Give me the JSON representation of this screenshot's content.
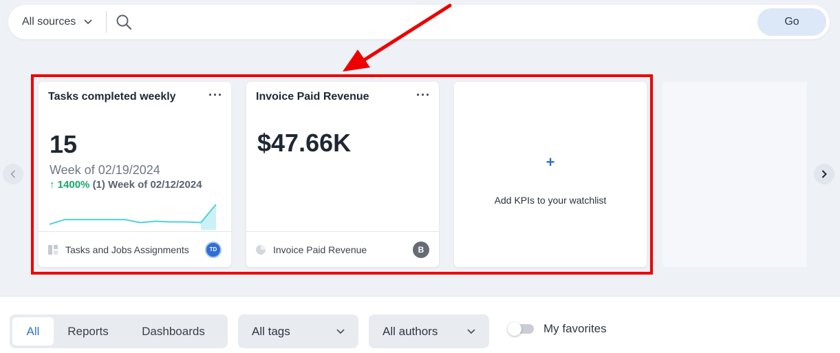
{
  "search": {
    "source_label": "All sources",
    "placeholder": "",
    "go_label": "Go"
  },
  "cards": [
    {
      "title": "Tasks completed weekly",
      "menu": "···",
      "value": "15",
      "period": "Week of 02/19/2024",
      "delta_arrow": "↑",
      "delta_pct": "1400%",
      "delta_rest": "(1) Week of 02/12/2024",
      "footer_label": "Tasks and Jobs Assignments",
      "avatar": "TD",
      "sparkline": [
        0.15,
        0.35,
        0.35,
        0.35,
        0.35,
        0.35,
        0.22,
        0.28,
        0.25,
        0.25,
        0.22,
        1.0
      ]
    },
    {
      "title": "Invoice Paid Revenue",
      "menu": "···",
      "value": "$47.66K",
      "footer_label": "Invoice Paid Revenue",
      "avatar": "B"
    },
    {
      "add_icon": "+",
      "add_label": "Add KPIs to your watchlist"
    }
  ],
  "filters": {
    "tabs": [
      "All",
      "Reports",
      "Dashboards"
    ],
    "selected_tab": "All",
    "tags_label": "All tags",
    "authors_label": "All authors",
    "favorites_label": "My favorites",
    "favorites_on": false
  },
  "colors": {
    "accent": "#2f6fd1",
    "positive": "#17a86a",
    "sparkline": "#4dd0e1",
    "annotation": "#ee0000"
  }
}
